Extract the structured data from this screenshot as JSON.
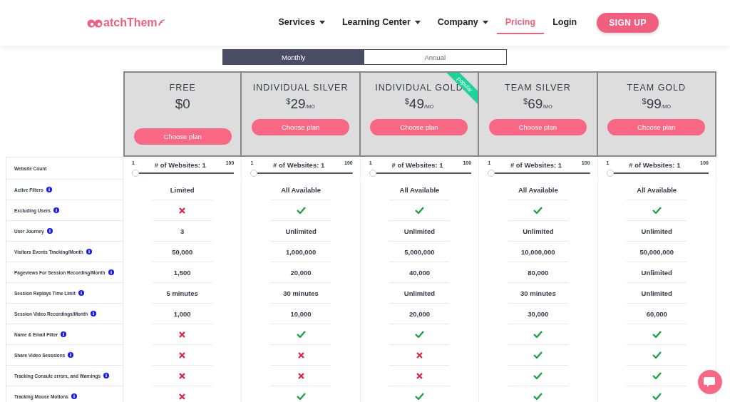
{
  "header": {
    "logo": "atchThem",
    "nav": [
      {
        "label": "Services",
        "dropdown": true,
        "selected": false
      },
      {
        "label": "Learning Center",
        "dropdown": true,
        "selected": false
      },
      {
        "label": "Company",
        "dropdown": true,
        "selected": false
      },
      {
        "label": "Pricing",
        "dropdown": false,
        "selected": true
      },
      {
        "label": "Login",
        "dropdown": false,
        "selected": false
      }
    ],
    "cta": "SIGN UP"
  },
  "billing_tabs": [
    {
      "label": "Monthly",
      "selected": true
    },
    {
      "label": "Annual",
      "selected": false
    }
  ],
  "plans": [
    {
      "name": "FREE",
      "amount": "$0",
      "popular": false,
      "button": "Choose plan"
    },
    {
      "name": "INDIVIDUAL SILVER",
      "currency": "$",
      "amount": "29",
      "period": "/MO",
      "popular": false,
      "button": "Choose plan"
    },
    {
      "name": "INDIVIDUAL GOLD",
      "currency": "$",
      "amount": "49",
      "period": "/MO",
      "popular": true,
      "badge": "popular",
      "button": "Choose plan"
    },
    {
      "name": "TEAM SILVER",
      "currency": "$",
      "amount": "69",
      "period": "/MO",
      "popular": false,
      "button": "Choose plan"
    },
    {
      "name": "TEAM GOLD",
      "currency": "$",
      "amount": "99",
      "period": "/MO",
      "popular": false,
      "button": "Choose plan"
    }
  ],
  "website_count": {
    "label": "Website Count",
    "sliders": [
      {
        "min": "1",
        "reading": "# of Websites: 1",
        "max": "100",
        "level": 0
      },
      {
        "min": "1",
        "reading": "# of Websites: 1",
        "max": "100",
        "level": 0
      },
      {
        "min": "1",
        "reading": "# of Websites: 1",
        "max": "100",
        "level": 0
      },
      {
        "min": "1",
        "reading": "# of Websites: 1",
        "max": "100",
        "level": 0
      },
      {
        "min": "1",
        "reading": "# of Websites: 1",
        "max": "100",
        "level": 0
      }
    ]
  },
  "features": [
    {
      "label": "Active Filters",
      "info": true,
      "cells": [
        {
          "kind": "text",
          "text": "Limited"
        },
        {
          "kind": "text",
          "text": "All Available"
        },
        {
          "kind": "text",
          "text": "All Available"
        },
        {
          "kind": "text",
          "text": "All Available"
        },
        {
          "kind": "text",
          "text": "All Available"
        }
      ]
    },
    {
      "label": "Excluding Users",
      "info": true,
      "cells": [
        {
          "kind": "no"
        },
        {
          "kind": "yes"
        },
        {
          "kind": "yes"
        },
        {
          "kind": "yes"
        },
        {
          "kind": "yes"
        }
      ]
    },
    {
      "label": "User Journey",
      "info": true,
      "cells": [
        {
          "kind": "text",
          "text": "3"
        },
        {
          "kind": "text",
          "text": "Unlimited"
        },
        {
          "kind": "text",
          "text": "Unlimited"
        },
        {
          "kind": "text",
          "text": "Unlimited"
        },
        {
          "kind": "text",
          "text": "Unlimited"
        }
      ]
    },
    {
      "label": "Visitors Events Tracking/Month",
      "info": true,
      "cells": [
        {
          "kind": "text",
          "text": "50,000"
        },
        {
          "kind": "text",
          "text": "1,000,000"
        },
        {
          "kind": "text",
          "text": "5,000,000"
        },
        {
          "kind": "text",
          "text": "10,000,000"
        },
        {
          "kind": "text",
          "text": "50,000,000"
        }
      ]
    },
    {
      "label": "Pageviews For Session Recording/Month",
      "info": true,
      "cells": [
        {
          "kind": "text",
          "text": "1,500"
        },
        {
          "kind": "text",
          "text": "20,000"
        },
        {
          "kind": "text",
          "text": "40,000"
        },
        {
          "kind": "text",
          "text": "80,000"
        },
        {
          "kind": "text",
          "text": "Unlimited"
        }
      ]
    },
    {
      "label": "Session Replays Time Limit",
      "info": true,
      "cells": [
        {
          "kind": "text",
          "text": "5 minutes"
        },
        {
          "kind": "text",
          "text": "30 minutes"
        },
        {
          "kind": "text",
          "text": "Unlimited"
        },
        {
          "kind": "text",
          "text": "30 minutes"
        },
        {
          "kind": "text",
          "text": "Unlimited"
        }
      ]
    },
    {
      "label": "Session Video Recordings/Month",
      "info": true,
      "cells": [
        {
          "kind": "text",
          "text": "1,000"
        },
        {
          "kind": "text",
          "text": "10,000"
        },
        {
          "kind": "text",
          "text": "20,000"
        },
        {
          "kind": "text",
          "text": "30,000"
        },
        {
          "kind": "text",
          "text": "60,000"
        }
      ]
    },
    {
      "label": "Name & Email Filter",
      "info": true,
      "cells": [
        {
          "kind": "no"
        },
        {
          "kind": "yes"
        },
        {
          "kind": "yes"
        },
        {
          "kind": "yes"
        },
        {
          "kind": "yes"
        }
      ]
    },
    {
      "label": "Share Video Sesssions",
      "info": true,
      "cells": [
        {
          "kind": "no"
        },
        {
          "kind": "no"
        },
        {
          "kind": "no"
        },
        {
          "kind": "yes"
        },
        {
          "kind": "yes"
        }
      ]
    },
    {
      "label": "Tracking Consule errors, and Warnings",
      "info": true,
      "cells": [
        {
          "kind": "no"
        },
        {
          "kind": "no"
        },
        {
          "kind": "no"
        },
        {
          "kind": "yes"
        },
        {
          "kind": "yes"
        }
      ]
    },
    {
      "label": "Tracking Mouse Motions",
      "info": true,
      "cells": [
        {
          "kind": "no"
        },
        {
          "kind": "yes"
        },
        {
          "kind": "yes"
        },
        {
          "kind": "yes"
        },
        {
          "kind": "yes"
        }
      ]
    }
  ]
}
